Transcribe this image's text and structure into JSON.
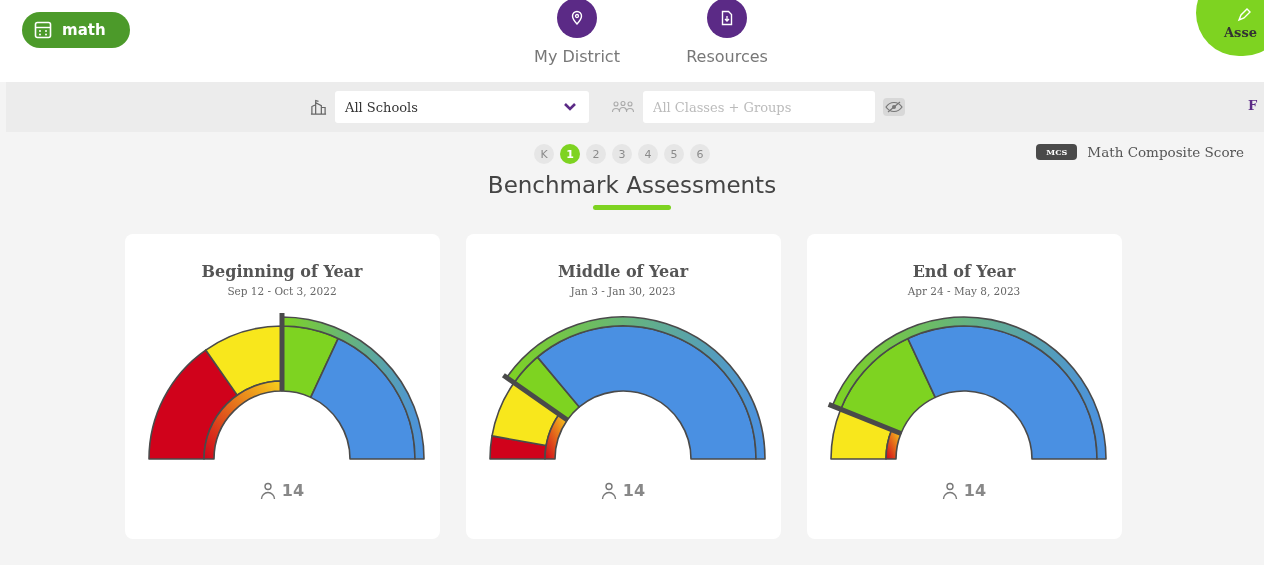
{
  "header": {
    "subject_button": {
      "label": "math"
    },
    "nav": [
      {
        "label": "My District",
        "selected": false
      },
      {
        "label": "Resources",
        "selected": false
      }
    ],
    "corner_button": {
      "label": "Asse"
    }
  },
  "filters": {
    "school_select": {
      "value": "All Schools"
    },
    "class_field": {
      "placeholder": "All Classes + Groups"
    },
    "edge_text": "F"
  },
  "grades": [
    {
      "label": "K",
      "selected": false
    },
    {
      "label": "1",
      "selected": true
    },
    {
      "label": "2",
      "selected": false
    },
    {
      "label": "3",
      "selected": false
    },
    {
      "label": "4",
      "selected": false
    },
    {
      "label": "5",
      "selected": false
    },
    {
      "label": "6",
      "selected": false
    }
  ],
  "legend": {
    "badge": "MCS",
    "label": "Math Composite Score"
  },
  "title": "Benchmark Assessments",
  "cards": [
    {
      "title": "Beginning of Year",
      "dates": "Sep 12 - Oct 3, 2022",
      "students": "14"
    },
    {
      "title": "Middle of Year",
      "dates": "Jan 3 - Jan 30, 2023",
      "students": "14"
    },
    {
      "title": "End of Year",
      "dates": "Apr 24 - May 8, 2023",
      "students": "14"
    }
  ]
}
